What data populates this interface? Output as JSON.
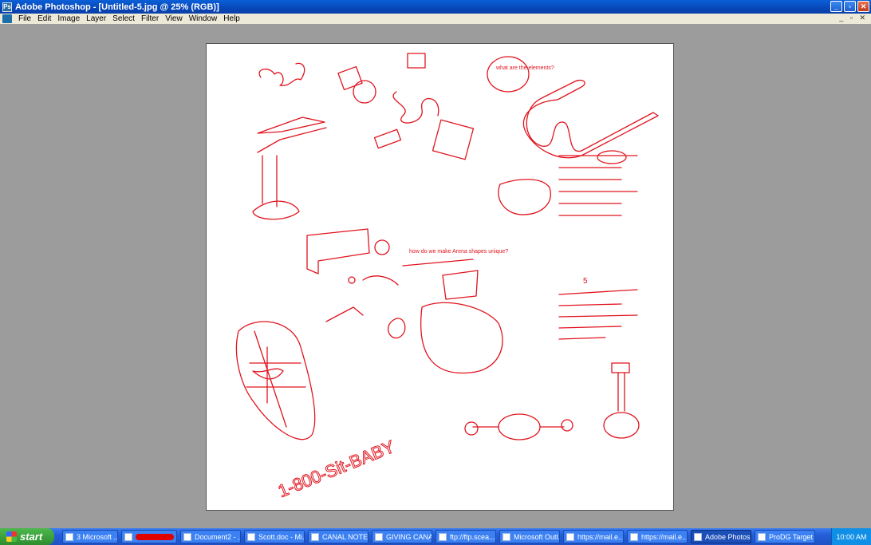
{
  "window": {
    "title": "Adobe Photoshop - [Untitled-5.jpg @ 25% (RGB)]",
    "app_icon": "photoshop-icon",
    "controls": [
      "minimize",
      "maximize",
      "close"
    ]
  },
  "menu": [
    "File",
    "Edit",
    "Image",
    "Layer",
    "Select",
    "Filter",
    "View",
    "Window",
    "Help"
  ],
  "canvas": {
    "sketch_color": "#e0141e",
    "texts": {
      "what_things": "what are the elements?",
      "how_make": "how do we make Arena shapes unique?",
      "hello": "1-800-Sit-BABY",
      "five": "5"
    }
  },
  "taskbar": {
    "start_label": "start",
    "tasks": [
      {
        "label": "3 Microsoft ...",
        "icon": "excel-icon"
      },
      {
        "label": "",
        "icon": "word-icon",
        "redacted": true
      },
      {
        "label": "Document2 - ...",
        "icon": "word-icon"
      },
      {
        "label": "Scott.doc - Mi...",
        "icon": "word-icon"
      },
      {
        "label": "CANAL NOTE...",
        "icon": "word-icon"
      },
      {
        "label": "GIVING CANA...",
        "icon": "word-icon"
      },
      {
        "label": "ftp://ftp.scea...",
        "icon": "ftp-icon"
      },
      {
        "label": "Microsoft Outl...",
        "icon": "outlook-icon"
      },
      {
        "label": "https://mail.e...",
        "icon": "browser-icon"
      },
      {
        "label": "https://mail.e...",
        "icon": "browser-icon"
      },
      {
        "label": "Adobe Photos...",
        "icon": "photoshop-icon",
        "active": true
      },
      {
        "label": "ProDG Target ...",
        "icon": "prodg-icon"
      }
    ],
    "clock": "10:00 AM"
  }
}
